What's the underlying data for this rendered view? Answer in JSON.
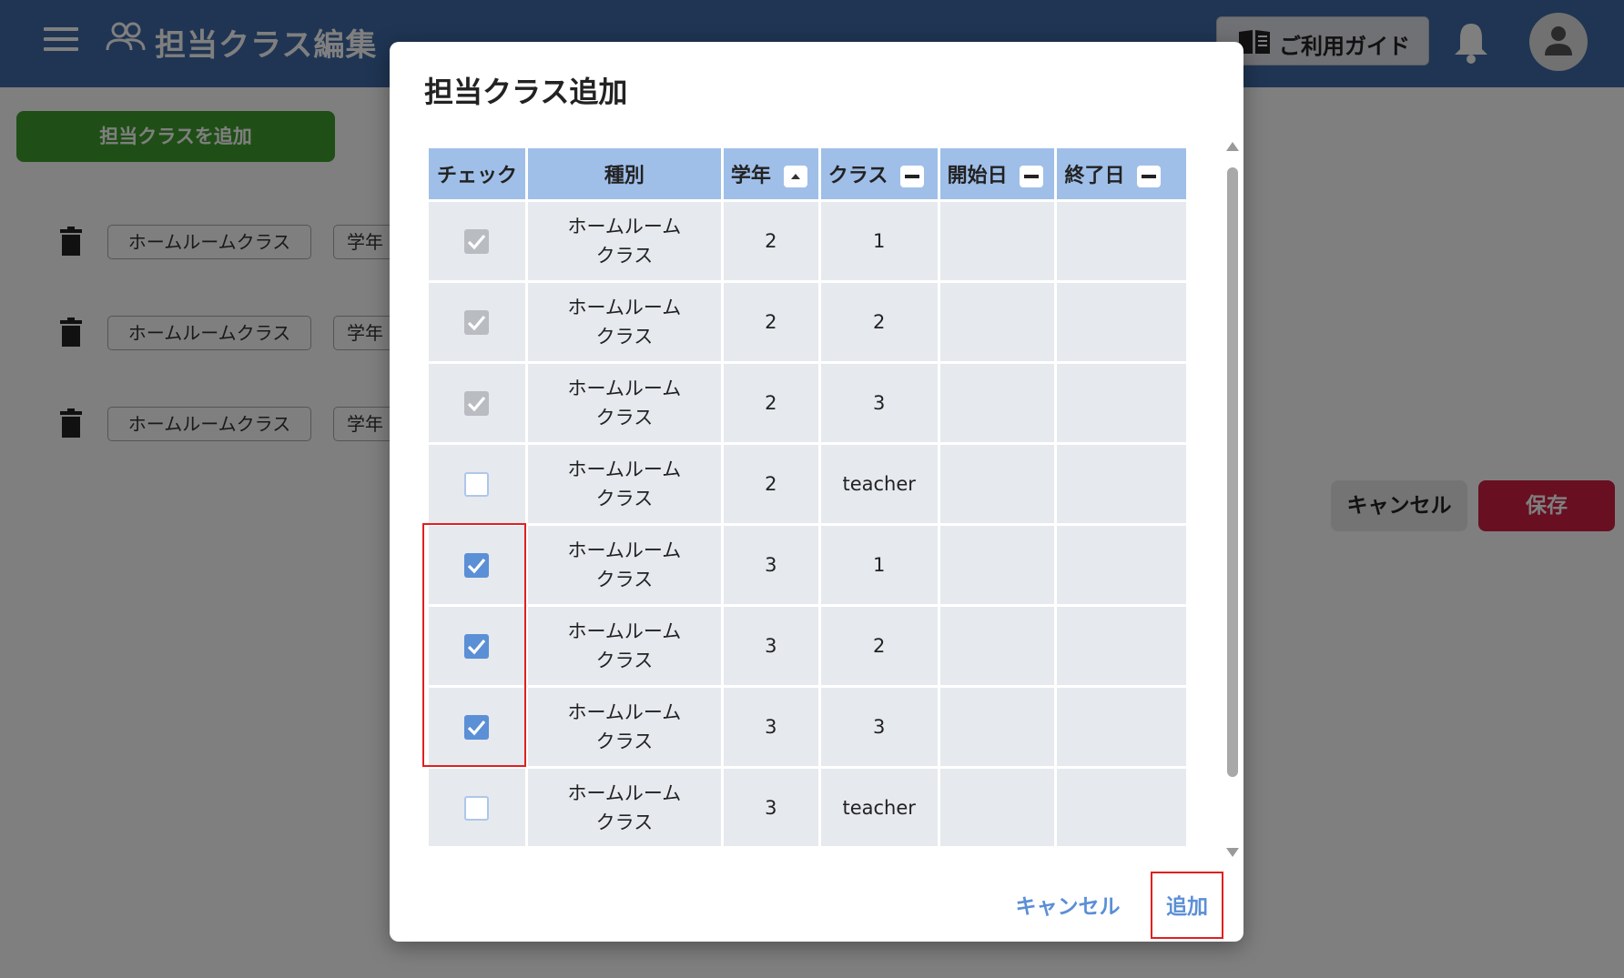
{
  "app": {
    "title": "担当クラス編集",
    "guide_label": "ご利用ガイド",
    "add_class_label": "担当クラスを追加",
    "rows": [
      {
        "type": "ホームルームクラス",
        "grade_label": "学年"
      },
      {
        "type": "ホームルームクラス",
        "grade_label": "学年"
      },
      {
        "type": "ホームルームクラス",
        "grade_label": "学年"
      }
    ],
    "cancel_label": "キャンセル",
    "save_label": "保存"
  },
  "dialog": {
    "title": "担当クラス追加",
    "columns": [
      "チェック",
      "種別",
      "学年",
      "クラス",
      "開始日",
      "終了日"
    ],
    "sort_states": {
      "学年": "ascending",
      "クラス": "none",
      "開始日": "none",
      "終了日": "none"
    },
    "rows": [
      {
        "check": "disabled-checked",
        "type": "ホームルームクラス",
        "grade": "2",
        "class": "1",
        "start": "",
        "end": ""
      },
      {
        "check": "disabled-checked",
        "type": "ホームルームクラス",
        "grade": "2",
        "class": "2",
        "start": "",
        "end": ""
      },
      {
        "check": "disabled-checked",
        "type": "ホームルームクラス",
        "grade": "2",
        "class": "3",
        "start": "",
        "end": ""
      },
      {
        "check": "unchecked",
        "type": "ホームルームクラス",
        "grade": "2",
        "class": "teacher",
        "start": "",
        "end": ""
      },
      {
        "check": "checked",
        "type": "ホームルームクラス",
        "grade": "3",
        "class": "1",
        "start": "",
        "end": ""
      },
      {
        "check": "checked",
        "type": "ホームルームクラス",
        "grade": "3",
        "class": "2",
        "start": "",
        "end": ""
      },
      {
        "check": "checked",
        "type": "ホームルームクラス",
        "grade": "3",
        "class": "3",
        "start": "",
        "end": ""
      },
      {
        "check": "unchecked",
        "type": "ホームルームクラス",
        "grade": "3",
        "class": "teacher",
        "start": "",
        "end": ""
      }
    ],
    "cancel_label": "キャンセル",
    "add_label": "追加"
  },
  "colors": {
    "appbar": "#3f6aa6",
    "header": "#9fbfe8",
    "cell": "#e6e9ee",
    "accent": "#5b8fd6",
    "highlight": "#e0201f",
    "save": "#d11f45",
    "add_class": "#3f9e2c"
  }
}
